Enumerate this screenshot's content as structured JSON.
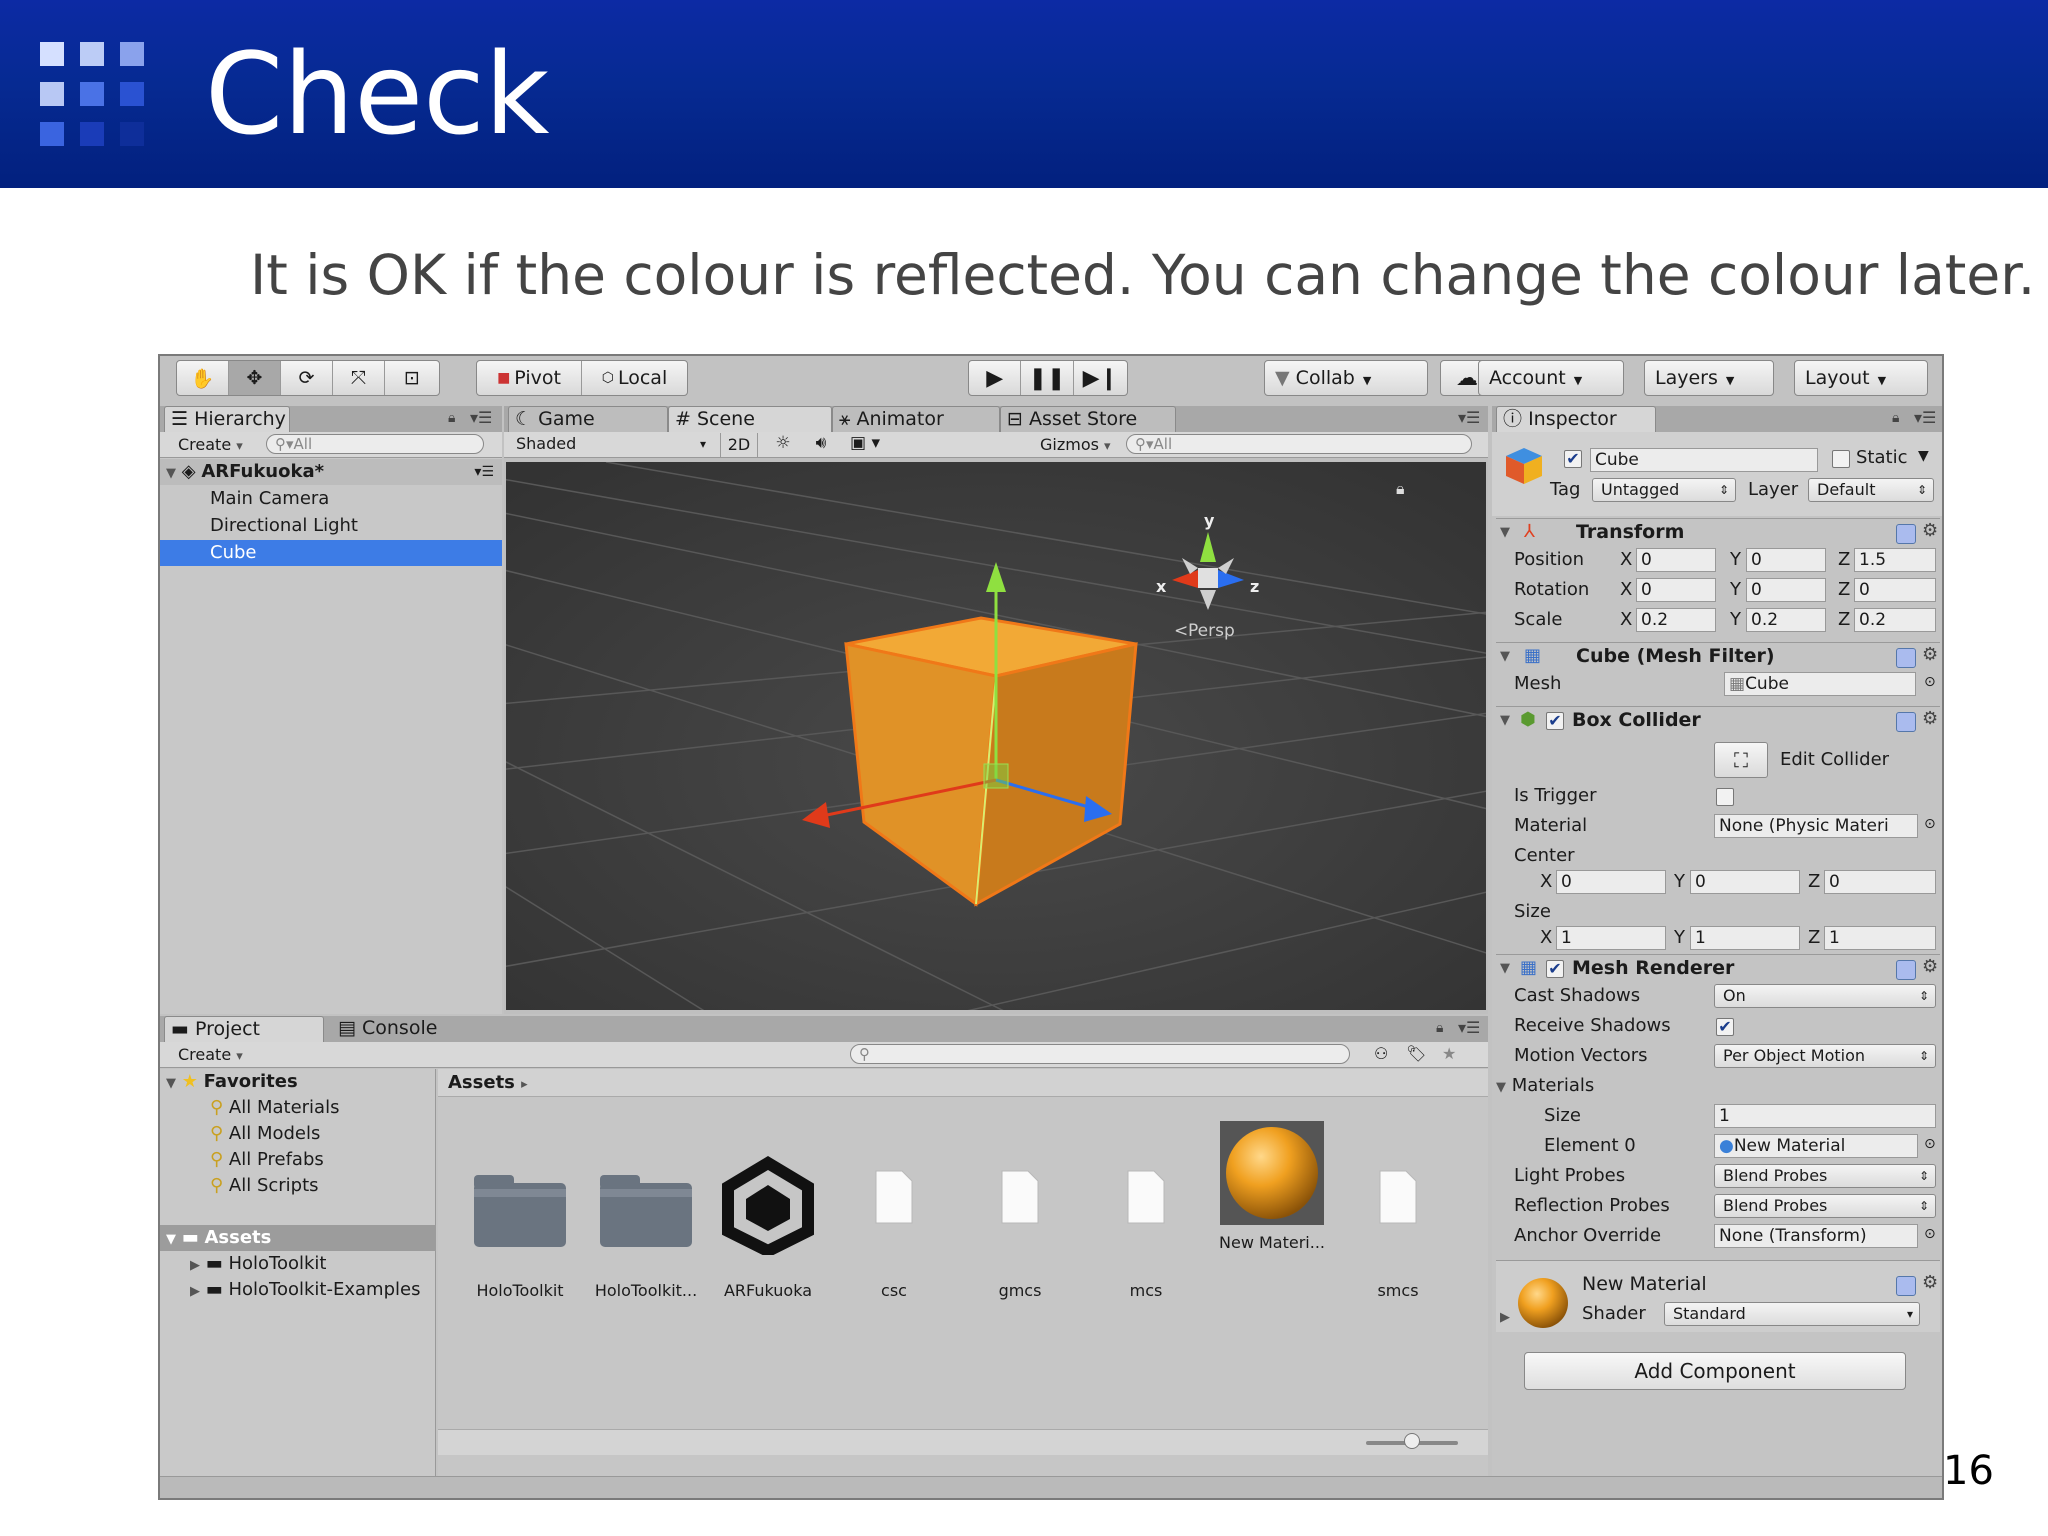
{
  "slide": {
    "title": "Check",
    "subtitle": "It is OK if the colour is reflected. You can change the colour later.",
    "page_number": "16"
  },
  "toolbar": {
    "pivot": "Pivot",
    "local": "Local",
    "collab": "Collab",
    "account": "Account",
    "layers": "Layers",
    "layout": "Layout"
  },
  "hierarchy": {
    "tab": "Hierarchy",
    "create": "Create",
    "search_placeholder": "All",
    "scene_name": "ARFukuoka*",
    "items": [
      "Main Camera",
      "Directional Light",
      "Cube"
    ],
    "selected": "Cube"
  },
  "scene_view": {
    "tabs": [
      "Game",
      "Scene",
      "Animator",
      "Asset Store"
    ],
    "shading": "Shaded",
    "mode_2d": "2D",
    "gizmos": "Gizmos",
    "search_placeholder": "All",
    "projection": "Persp",
    "axis_labels": {
      "x": "x",
      "y": "y",
      "z": "z"
    },
    "cube_color": "#e99b2a",
    "selection_color": "#f07818"
  },
  "project": {
    "tabs": [
      "Project",
      "Console"
    ],
    "create": "Create",
    "favorites_label": "Favorites",
    "favorites": [
      "All Materials",
      "All Models",
      "All Prefabs",
      "All Scripts"
    ],
    "assets_label": "Assets",
    "asset_folders": [
      "HoloToolkit",
      "HoloToolkit-Examples"
    ],
    "breadcrumb": "Assets",
    "assets": [
      {
        "name": "HoloToolkit",
        "kind": "folder"
      },
      {
        "name": "HoloToolkit...",
        "kind": "folder"
      },
      {
        "name": "ARFukuoka",
        "kind": "unity"
      },
      {
        "name": "csc",
        "kind": "file"
      },
      {
        "name": "gmcs",
        "kind": "file"
      },
      {
        "name": "mcs",
        "kind": "file"
      },
      {
        "name": "New Materi...",
        "kind": "material"
      },
      {
        "name": "smcs",
        "kind": "file"
      }
    ]
  },
  "inspector": {
    "tab": "Inspector",
    "object_name": "Cube",
    "static_label": "Static",
    "tag_label": "Tag",
    "tag_value": "Untagged",
    "layer_label": "Layer",
    "layer_value": "Default",
    "transform": {
      "title": "Transform",
      "position_label": "Position",
      "rotation_label": "Rotation",
      "scale_label": "Scale",
      "position": [
        "0",
        "0",
        "1.5"
      ],
      "rotation": [
        "0",
        "0",
        "0"
      ],
      "scale": [
        "0.2",
        "0.2",
        "0.2"
      ]
    },
    "mesh_filter": {
      "title": "Cube (Mesh Filter)",
      "mesh_label": "Mesh",
      "mesh_value": "Cube"
    },
    "box_collider": {
      "title": "Box Collider",
      "edit_collider": "Edit Collider",
      "is_trigger_label": "Is Trigger",
      "material_label": "Material",
      "material_value": "None (Physic Materi",
      "center_label": "Center",
      "center": [
        "0",
        "0",
        "0"
      ],
      "size_label": "Size",
      "size": [
        "1",
        "1",
        "1"
      ]
    },
    "mesh_renderer": {
      "title": "Mesh Renderer",
      "cast_shadows_label": "Cast Shadows",
      "cast_shadows_value": "On",
      "receive_shadows_label": "Receive Shadows",
      "motion_vectors_label": "Motion Vectors",
      "motion_vectors_value": "Per Object Motion",
      "materials_label": "Materials",
      "size_label": "Size",
      "size_value": "1",
      "element0_label": "Element 0",
      "element0_value": "New Material",
      "light_probes_label": "Light Probes",
      "light_probes_value": "Blend Probes",
      "reflection_probes_label": "Reflection Probes",
      "reflection_probes_value": "Blend Probes",
      "anchor_override_label": "Anchor Override",
      "anchor_override_value": "None (Transform)"
    },
    "material": {
      "name": "New Material",
      "shader_label": "Shader",
      "shader_value": "Standard"
    },
    "add_component": "Add Component"
  },
  "axis_letters": {
    "x": "X",
    "y": "Y",
    "z": "Z"
  },
  "colors": {
    "banner": "#062a92",
    "selection": "#3d7ce6",
    "material": "#f0a020"
  }
}
